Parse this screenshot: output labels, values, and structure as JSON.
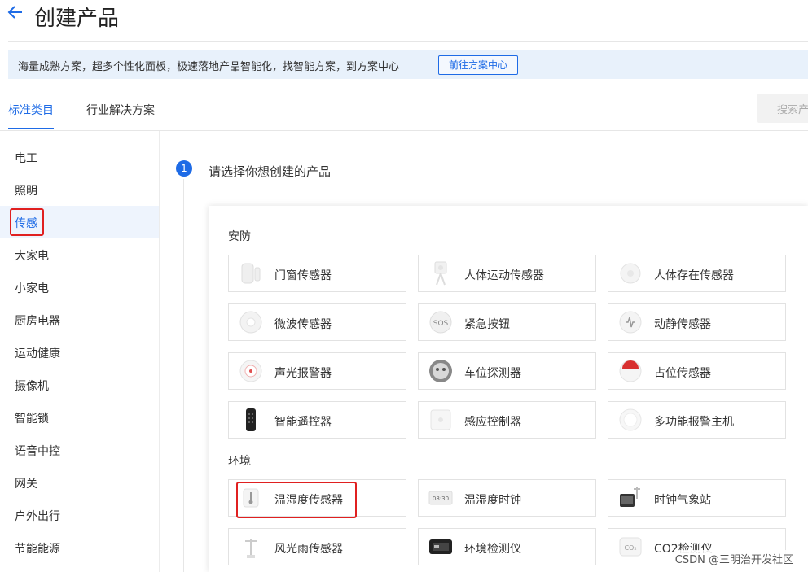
{
  "header": {
    "back_icon": "arrow-left-icon",
    "title": "创建产品"
  },
  "banner": {
    "text": "海量成熟方案，超多个性化面板，极速落地产品智能化，找智能方案，到方案中心",
    "button": "前往方案中心"
  },
  "tabs": [
    {
      "label": "标准类目",
      "active": true
    },
    {
      "label": "行业解决方案",
      "active": false
    }
  ],
  "search": {
    "placeholder": "搜索产"
  },
  "sidebar": {
    "items": [
      {
        "label": "电工"
      },
      {
        "label": "照明"
      },
      {
        "label": "传感",
        "active": true,
        "highlighted": true
      },
      {
        "label": "大家电"
      },
      {
        "label": "小家电"
      },
      {
        "label": "厨房电器"
      },
      {
        "label": "运动健康"
      },
      {
        "label": "摄像机"
      },
      {
        "label": "智能锁"
      },
      {
        "label": "语音中控"
      },
      {
        "label": "网关"
      },
      {
        "label": "户外出行"
      },
      {
        "label": "节能能源"
      }
    ]
  },
  "step": {
    "number": "1",
    "text": "请选择你想创建的产品"
  },
  "categories": [
    {
      "title": "安防",
      "products": [
        {
          "label": "门窗传感器",
          "icon": "door-sensor-icon"
        },
        {
          "label": "人体运动传感器",
          "icon": "motion-sensor-icon"
        },
        {
          "label": "人体存在传感器",
          "icon": "presence-sensor-icon"
        },
        {
          "label": "微波传感器",
          "icon": "microwave-sensor-icon"
        },
        {
          "label": "紧急按钮",
          "icon": "sos-button-icon"
        },
        {
          "label": "动静传感器",
          "icon": "vibration-sensor-icon"
        },
        {
          "label": "声光报警器",
          "icon": "siren-icon"
        },
        {
          "label": "车位探测器",
          "icon": "parking-detector-icon"
        },
        {
          "label": "占位传感器",
          "icon": "occupancy-sensor-icon"
        },
        {
          "label": "智能遥控器",
          "icon": "remote-control-icon"
        },
        {
          "label": "感应控制器",
          "icon": "sensing-controller-icon"
        },
        {
          "label": "多功能报警主机",
          "icon": "alarm-hub-icon"
        }
      ]
    },
    {
      "title": "环境",
      "products": [
        {
          "label": "温湿度传感器",
          "icon": "thermometer-icon",
          "highlighted": true
        },
        {
          "label": "温湿度时钟",
          "icon": "clock-display-icon",
          "display_text": "08:30"
        },
        {
          "label": "时钟气象站",
          "icon": "weather-station-icon"
        },
        {
          "label": "风光雨传感器",
          "icon": "wind-sensor-icon"
        },
        {
          "label": "环境检测仪",
          "icon": "env-monitor-icon"
        },
        {
          "label": "CO2检测仪",
          "icon": "co2-monitor-icon",
          "badge_text": "CO₂"
        }
      ]
    }
  ],
  "watermark": "CSDN @三明治开发社区",
  "colors": {
    "accent": "#1e6be6",
    "highlight": "#e02020",
    "banner_bg": "#e8f1fb"
  }
}
